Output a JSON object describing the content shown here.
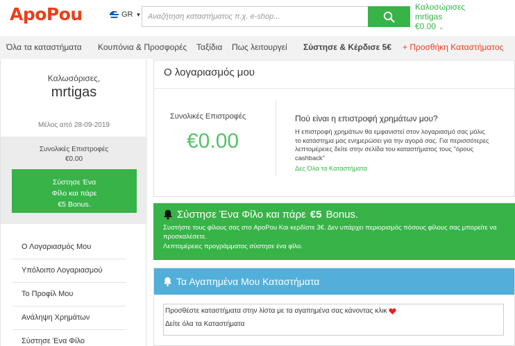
{
  "header": {
    "logo": "ApoPou",
    "lang": "GR",
    "search_placeholder": "Αναζήτηση καταστήματος π.χ. e-shop...",
    "user_greeting": "Καλοσώρισες",
    "user_name": "mrtigas",
    "user_balance": "€0.00"
  },
  "nav": {
    "all_stores": "Όλα τα καταστήματα",
    "coupons": "Κουπόνια & Προσφορές",
    "travel": "Ταξίδια",
    "how_it_works": "Πως λειτουργεί",
    "refer": "Σύστησε & Κέρδισε 5€",
    "add_store": "+ Προσθήκη Καταστήματος"
  },
  "sidebar": {
    "welcome": "Καλωσόρισες,",
    "username": "mrtigas",
    "member_since": "Μέλος από 28-09-2019",
    "total_returns_label": "Συνολικές Επιστροφές",
    "total_returns_value": "€0.00",
    "refer_line1": "Σύστησε Ένα",
    "refer_line2": "Φίλο και πάρε",
    "refer_line3": "€5 Bonus.",
    "menu": [
      {
        "label": "Ο Λογαριασμός Μου"
      },
      {
        "label": "Υπόλοιπο Λογαριασμού"
      },
      {
        "label": "Το Προφίλ Μου"
      },
      {
        "label": "Ανάληψη Χρημάτων"
      },
      {
        "label": "Σύστησε Ένα Φίλο"
      }
    ]
  },
  "account": {
    "title": "Ο λογαριασμός μου",
    "total_label": "Συνολικές Επιστροφές",
    "total_value": "€0.00",
    "question": "Πού είναι η επιστροφή χρημάτων μου?",
    "answer": "Η επιστροφή χρημάτων θα εμφανιστεί στον λογαριασμό σας μόλις το κατάστημα μας ενημερώσει για την αγορά σας. Για περισσότερες λεπτομέρειες δείτε στην σελίδα του καταστήματος τους \"όρους cashback\"",
    "link": "Δες Όλα τα Καταστήματα"
  },
  "referral": {
    "title_prefix": "Σύστησε Ένα Φίλο και πάρε",
    "title_bold": "€5",
    "title_suffix": "Bonus.",
    "text": "Συστήστε τους φίλους σας στο ApoPou Και κερδίστε 3€. Δεν υπάρχει περιορισμός πόσους φίλους σας μπορείτε να προσκαλέσετε.",
    "details": "Λεπτομέρειες προγράμματος σύστησε ένα φίλο."
  },
  "favorites": {
    "title": "Τα Αγαπημένα Μου Καταστήματα",
    "instruction": "Προσθέστε καταστήματα στην λίστα με τα αγαπημένα σας κάνοντας κλικ",
    "link": "Δείτε όλα τα Καταστήματα"
  },
  "colors": {
    "brand_red": "#e8401c",
    "brand_green": "#37b348",
    "favorites_blue": "#52afd9"
  }
}
